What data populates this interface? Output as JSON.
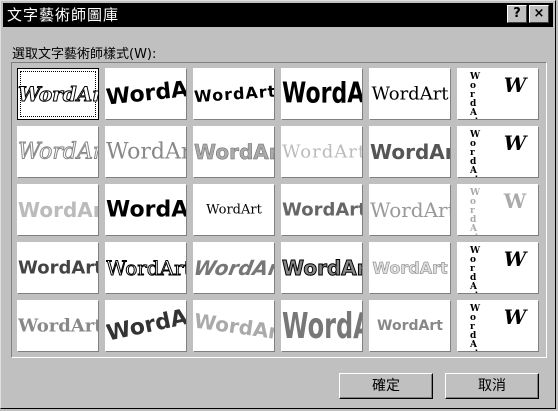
{
  "window": {
    "title": "文字藝術師圖庫",
    "help_label": "?",
    "close_label": "×"
  },
  "prompt": {
    "label": "選取文字藝術師樣式(W):"
  },
  "gallery": {
    "word": "WordArt",
    "vertical_word": "WordArt",
    "w_letter": "W",
    "selected_index": 0
  },
  "buttons": {
    "ok": "確定",
    "cancel": "取消"
  }
}
